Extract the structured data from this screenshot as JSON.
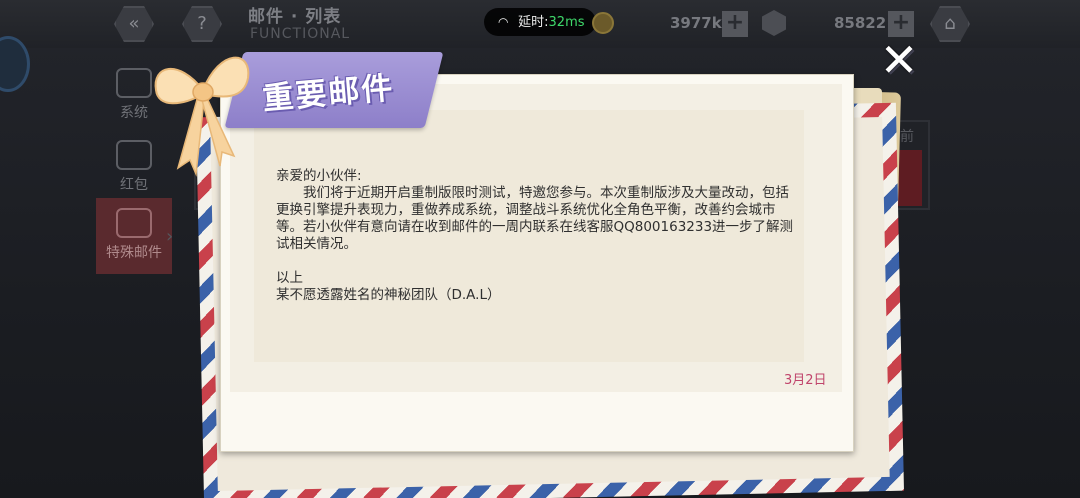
{
  "topbar": {
    "title": "邮件 · 列表",
    "subtitle": "FUNCTIONAL",
    "ping_label": "延时:",
    "ping_value": "32ms",
    "resource_1": "3977k",
    "resource_2": "85822",
    "back_icon": "chevron-left-icon",
    "help_icon": "question-icon",
    "home_icon": "home-icon"
  },
  "sidebar": {
    "items": [
      {
        "label": "系统"
      },
      {
        "label": "红包"
      },
      {
        "label": "特殊邮件",
        "active": true
      }
    ],
    "background_tab": "时前"
  },
  "mail": {
    "banner_title": "重要邮件",
    "greeting": "亲爱的小伙伴:",
    "body": "我们将于近期开启重制版限时测试，特邀您参与。本次重制版涉及大量改动，包括更换引擎提升表现力，重做养成系统，调整战斗系统优化全角色平衡，改善约会城市等。若小伙伴有意向请在收到邮件的一周内联系在线客服QQ800163233进一步了解测试相关情况。",
    "closing": "以上",
    "signature": "某不愿透露姓名的神秘团队（D.A.L）",
    "date": "3月2日"
  },
  "colors": {
    "banner": "#9a8cd2",
    "date": "#c0446b",
    "ping_value": "#3fd96b",
    "active_tab": "#5a2a2e"
  },
  "close_label": "✕"
}
